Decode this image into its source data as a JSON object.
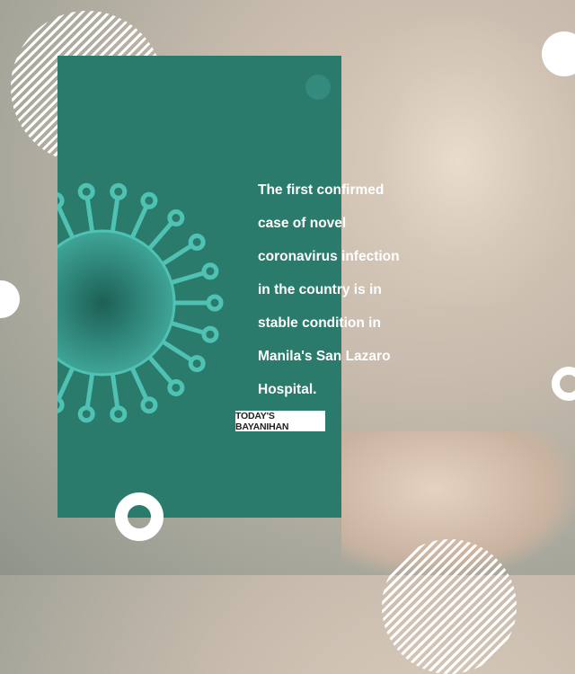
{
  "post": {
    "body_lines": [
      "The first confirmed",
      "case of novel",
      "coronavirus infection",
      "in the country is in",
      "stable condition in",
      "Manila's San Lazaro",
      "Hospital."
    ],
    "source_label": "TODAY'S BAYANIHAN"
  },
  "colors": {
    "card": "#2b7b6c",
    "virus": "#4fc2b4"
  }
}
